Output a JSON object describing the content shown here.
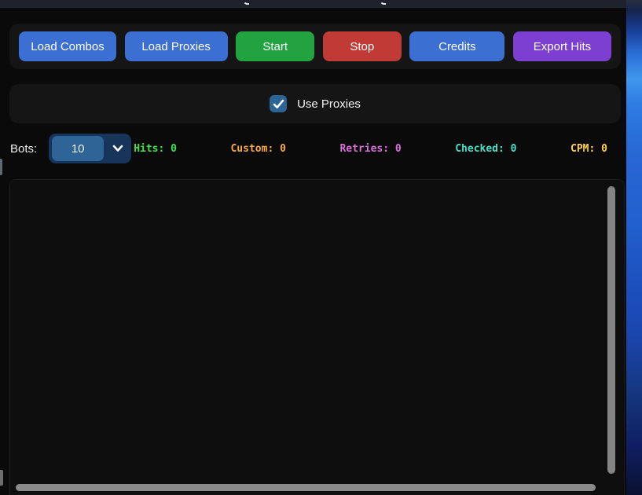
{
  "toolbar": {
    "buttons": [
      {
        "label": "Load Combos",
        "bg": "#3b6fd1"
      },
      {
        "label": "Load Proxies",
        "bg": "#3b6fd1"
      },
      {
        "label": "Start",
        "bg": "#23a33f"
      },
      {
        "label": "Stop",
        "bg": "#c03a36"
      },
      {
        "label": "Credits",
        "bg": "#3b6fd1"
      },
      {
        "label": "Export Hits",
        "bg": "#7c3fd0"
      }
    ]
  },
  "proxies": {
    "label": "Use Proxies",
    "checked": true,
    "checkbox_color": "#2d6496"
  },
  "controls": {
    "bots_label": "Bots:",
    "bots_value": "10"
  },
  "stats": [
    {
      "label": "Hits:",
      "value": "0",
      "color": "#3ce24a"
    },
    {
      "label": "Custom:",
      "value": "0",
      "color": "#f7a93c"
    },
    {
      "label": "Retries:",
      "value": "0",
      "color": "#d96fd9"
    },
    {
      "label": "Checked:",
      "value": "0",
      "color": "#49e0cb"
    },
    {
      "label": "CPM:",
      "value": "0",
      "color": "#ffd24a"
    }
  ],
  "log": {
    "content": ""
  },
  "colors": {
    "window_bg": "#0a0a0a",
    "panel_bg": "#151515",
    "titlebar_bg": "#1d222c",
    "scrollbar_thumb": "#848484",
    "wallpaper_blue": "#2766d4"
  }
}
